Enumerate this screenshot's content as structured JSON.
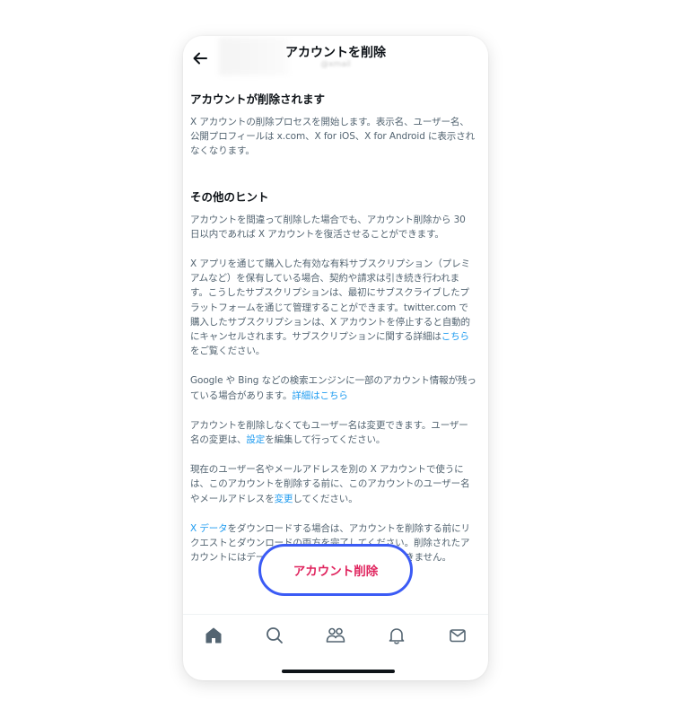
{
  "header": {
    "title": "アカウントを削除",
    "subtitle": "@xmail"
  },
  "sections": {
    "deactivate_heading": "アカウントが削除されます",
    "deactivate_p1": "X アカウントの削除プロセスを開始します。表示名、ユーザー名、",
    "deactivate_p2": "公開プロフィールは x.com、X for iOS、X for Android に表示され",
    "deactivate_p3": "なくなります。",
    "hints_heading": "その他のヒント",
    "h1_l1": "アカウントを間違って削除した場合でも、アカウント削除から 30",
    "h1_l2": "日以内であれば X アカウントを復活させることができます。",
    "h2_l1": "X アプリを通じて購入した有効な有料サブスクリプション（プレミ",
    "h2_l2": "アムなど）を保有している場合、契約や請求は引き続き行われま",
    "h2_l3": "す。こうしたサブスクリプションは、最初にサブスクライブしたプ",
    "h2_l4": "ラットフォームを通じて管理することができます。twitter.com で",
    "h2_l5": "購入したサブスクリプションは、X アカウントを停止すると自動的",
    "h2_l6a": "にキャンセルされます。サブスクリプションに関する詳細は",
    "h2_l6_link": "こちら",
    "h2_l7": "をご覧ください。",
    "h3_l1": "Google や Bing などの検索エンジンに一部のアカウント情報が残っ",
    "h3_l2a": "ている場合があります。",
    "h3_l2_link": "詳細はこちら",
    "h4_l1": "アカウントを削除しなくてもユーザー名は変更できます。ユーザー",
    "h4_l2a": "名の変更は、",
    "h4_l2_link": "設定",
    "h4_l2b": "を編集して行ってください。",
    "h5_l1": "現在のユーザー名やメールアドレスを別の X アカウントで使うに",
    "h5_l2": "は、このアカウントを削除する前に、このアカウントのユーザー名",
    "h5_l3a": "やメールアドレスを",
    "h5_l3_link": "変更",
    "h5_l3b": "してください。",
    "h6_l1_link": "X データ",
    "h6_l1b": "をダウンロードする場合は、アカウントを削除する前にリ",
    "h6_l2": "クエストとダウンロードの両方を完了してください。削除されたア",
    "h6_l3": "カウントにはデータのダウンロードリンクを送信できません。"
  },
  "delete_button": {
    "label": "アカウント削除"
  },
  "tabbar": {
    "icons": [
      "home-icon",
      "search-icon",
      "communities-icon",
      "notifications-icon",
      "messages-icon"
    ]
  },
  "colors": {
    "link": "#1d9bf0",
    "delete_text": "#e0245e",
    "button_border": "#3b5bf5",
    "body_text": "#536471"
  }
}
